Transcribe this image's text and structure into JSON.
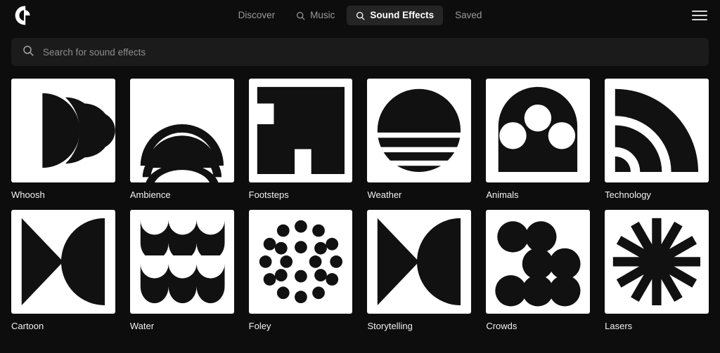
{
  "app": {
    "logo_icon": "epidemic-sound-logo",
    "background_color": "#0d0d0d",
    "tile_color": "#ffffff",
    "accent_color": "#252525"
  },
  "header": {
    "nav_items": [
      {
        "label": "Discover",
        "icon": "",
        "active": false
      },
      {
        "label": "Music",
        "icon": "search-icon",
        "active": false
      },
      {
        "label": "Sound Effects",
        "icon": "search-icon",
        "active": true
      },
      {
        "label": "Saved",
        "icon": "",
        "active": false
      }
    ],
    "menu_icon": "hamburger-menu-icon"
  },
  "search": {
    "icon": "search-icon",
    "placeholder": "Search for sound effects",
    "value": ""
  },
  "categories": [
    {
      "label": "Whoosh",
      "icon": "whoosh-crescents-icon"
    },
    {
      "label": "Ambience",
      "icon": "ambience-arcs-icon"
    },
    {
      "label": "Footsteps",
      "icon": "footsteps-stairs-icon"
    },
    {
      "label": "Weather",
      "icon": "weather-sun-bands-icon"
    },
    {
      "label": "Animals",
      "icon": "animals-paw-icon"
    },
    {
      "label": "Technology",
      "icon": "technology-signal-icon"
    },
    {
      "label": "Cartoon",
      "icon": "cartoon-triangle-halfdisc-icon"
    },
    {
      "label": "Water",
      "icon": "water-waves-icon"
    },
    {
      "label": "Foley",
      "icon": "foley-dots-icon"
    },
    {
      "label": "Storytelling",
      "icon": "storytelling-triangle-halfdisc-icon"
    },
    {
      "label": "Crowds",
      "icon": "crowds-circles-icon"
    },
    {
      "label": "Lasers",
      "icon": "lasers-starburst-icon"
    }
  ]
}
